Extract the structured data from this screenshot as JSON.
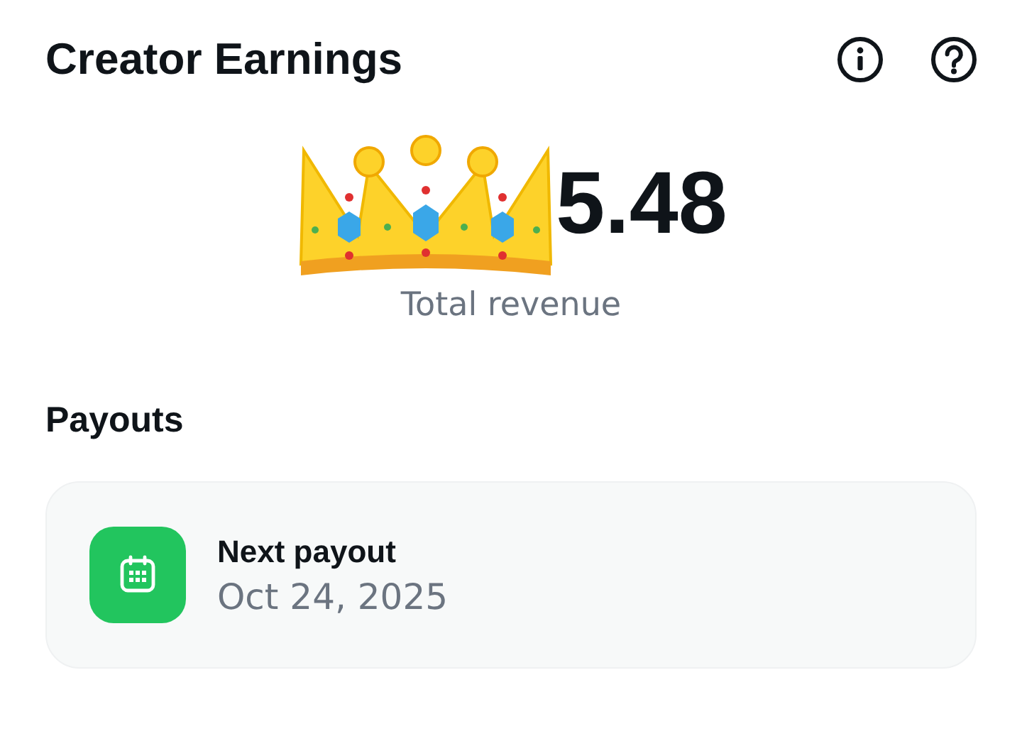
{
  "header": {
    "title": "Creator Earnings"
  },
  "revenue": {
    "amount": "5.48",
    "label": "Total revenue"
  },
  "payouts": {
    "heading": "Payouts",
    "card": {
      "title": "Next payout",
      "date": "Oct 24, 2025"
    }
  }
}
